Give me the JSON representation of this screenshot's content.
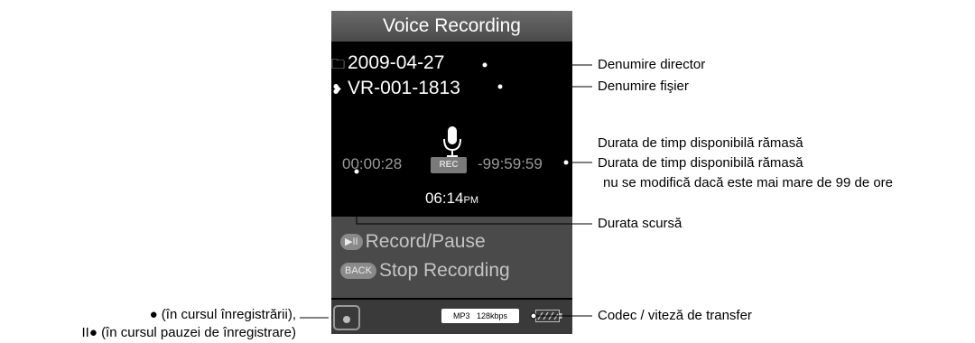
{
  "device": {
    "title": "Voice Recording",
    "folder_name": "2009-04-27",
    "file_name": "VR-001-1813",
    "elapsed_time": "00:00:28",
    "rec_badge": "REC",
    "remaining_time": "-99:59:59",
    "clock_time": "06:14",
    "clock_period": "PM",
    "controls": [
      {
        "key": "▶II",
        "label": "Record/Pause"
      },
      {
        "key": "BACK",
        "label": "Stop Recording"
      }
    ],
    "codec": "MP3",
    "bitrate": "128kbps"
  },
  "icons": [
    "folder-icon",
    "file-voice-icon",
    "microphone-icon",
    "play-pause-key-icon",
    "back-key-icon",
    "record-indicator-icon",
    "battery-icon"
  ],
  "annotations": {
    "folder_name": "Denumire director",
    "file_name": "Denumire fişier",
    "remaining_1": "Durata de timp disponibilă rămasă",
    "remaining_2": "Durata de timp disponibilă rămasă",
    "remaining_3": "nu se modifică dacă este mai mare de 99 de ore",
    "elapsed": "Durata scursă",
    "codec": "Codec / viteză de transfer",
    "status_1": "● (în cursul înregistrării),",
    "status_2": "II● (în cursul pauzei de  înregistrare)"
  },
  "colors": {
    "screen_bg": "#000000",
    "panel_gray": "#4a4a4a",
    "text_white": "#ffffff",
    "text_gray": "#9a9a9a"
  }
}
